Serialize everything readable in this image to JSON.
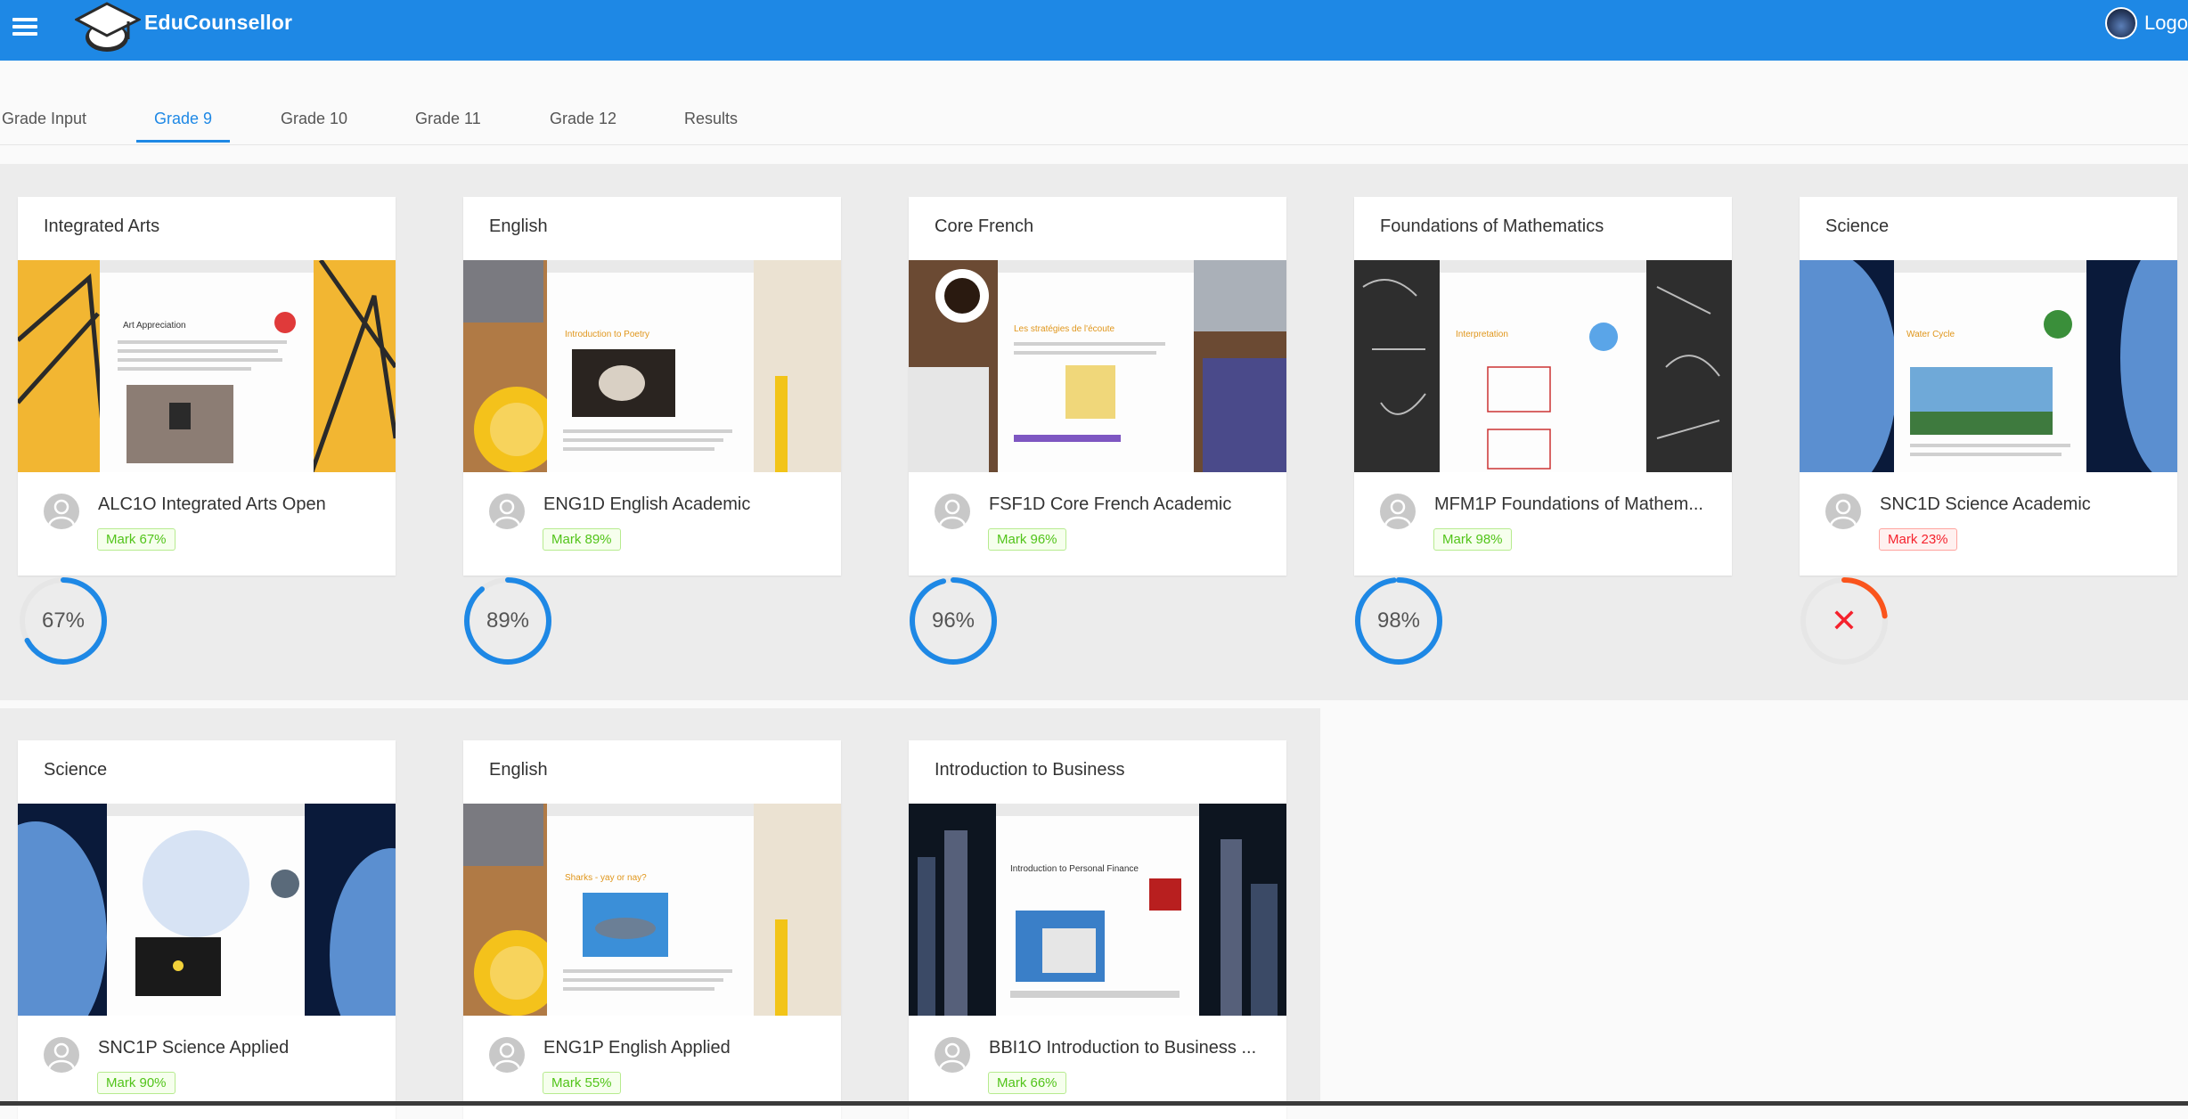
{
  "app": {
    "brand": "EduCounsellor",
    "logout_label": "Logo"
  },
  "tabs": [
    {
      "label": "Grade Input"
    },
    {
      "label": "Grade 9"
    },
    {
      "label": "Grade 10"
    },
    {
      "label": "Grade 11"
    },
    {
      "label": "Grade 12"
    },
    {
      "label": "Results"
    }
  ],
  "active_tab": "Grade 9",
  "colors": {
    "header": "#1e88e5",
    "progress_pass": "#1e88e5",
    "progress_fail": "#fa541c",
    "mark_pass": "#52c41a",
    "mark_fail": "#f5222d"
  },
  "courses": [
    {
      "subject": "Integrated Arts",
      "course": "ALC1O Integrated Arts Open",
      "mark": "Mark 67%",
      "percent": 67,
      "progress_label": "67%",
      "status": "pass",
      "image_icon": "art-appreciation-screenshot"
    },
    {
      "subject": "English",
      "course": "ENG1D English Academic",
      "mark": "Mark 89%",
      "percent": 89,
      "progress_label": "89%",
      "status": "pass",
      "image_icon": "poetry-screenshot"
    },
    {
      "subject": "Core French",
      "course": "FSF1D Core French Academic",
      "mark": "Mark 96%",
      "percent": 96,
      "progress_label": "96%",
      "status": "pass",
      "image_icon": "french-strategies-screenshot"
    },
    {
      "subject": "Foundations of Mathematics",
      "course": "MFM1P Foundations of Mathem...",
      "mark": "Mark 98%",
      "percent": 98,
      "progress_label": "98%",
      "status": "pass",
      "image_icon": "math-interpretation-screenshot"
    },
    {
      "subject": "Science",
      "course": "SNC1D Science Academic",
      "mark": "Mark 23%",
      "percent": 23,
      "progress_label": "",
      "status": "fail",
      "image_icon": "water-cycle-screenshot"
    },
    {
      "subject": "Science",
      "course": "SNC1P Science Applied",
      "mark": "Mark 90%",
      "percent": 90,
      "status": "pass",
      "image_icon": "astronomy-screenshot"
    },
    {
      "subject": "English",
      "course": "ENG1P English Applied",
      "mark": "Mark 55%",
      "percent": 55,
      "status": "pass",
      "image_icon": "sharks-screenshot"
    },
    {
      "subject": "Introduction to Business",
      "course": "BBI1O Introduction to Business ...",
      "mark": "Mark 66%",
      "percent": 66,
      "status": "pass",
      "image_icon": "personal-finance-screenshot"
    }
  ]
}
